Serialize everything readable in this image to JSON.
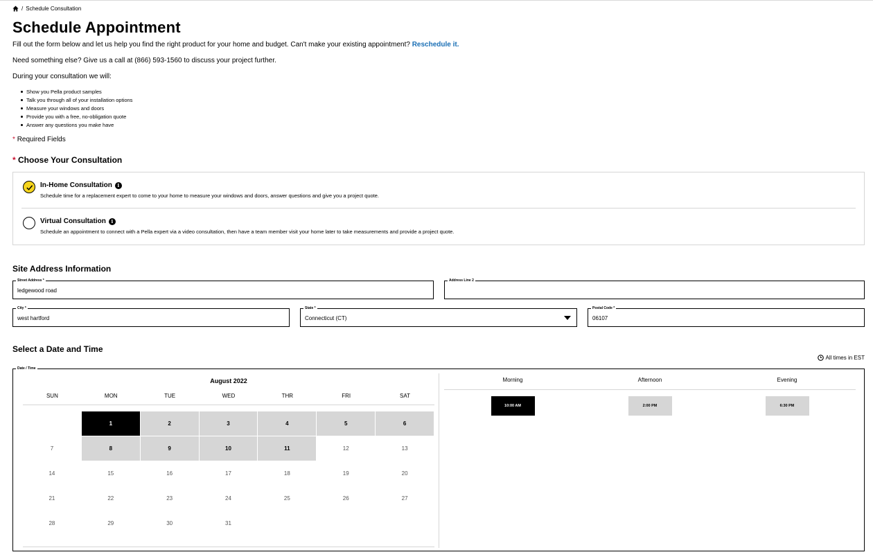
{
  "breadcrumb": {
    "separator": "/",
    "current": "Schedule Consultation"
  },
  "page_title": "Schedule Appointment",
  "intro": {
    "text": "Fill out the form below and let us help you find the right product for your home and budget. Can't make your existing appointment?",
    "link": "Reschedule it."
  },
  "call_text": "Need something else? Give us a call at (866) 593-1560 to discuss your project further.",
  "during_text": "During your consultation we will:",
  "bullets": [
    "Show you Pella product samples",
    "Talk you through all of your installation options",
    "Measure your windows and doors",
    "Provide you with a free, no-obligation quote",
    "Answer any questions you make have"
  ],
  "required": {
    "star": "*",
    "text": "Required Fields"
  },
  "choose": {
    "star": "*",
    "title": "Choose Your Consultation"
  },
  "consultations": [
    {
      "title": "In-Home Consultation",
      "desc": "Schedule time for a replacement expert to come to your home to measure your windows and doors, answer questions and give you a project quote.",
      "selected": true
    },
    {
      "title": "Virtual Consultation",
      "desc": "Schedule an appointment to connect with a Pella expert via a video consultation, then have a team member visit your home later to take measurements and provide a project quote.",
      "selected": false
    }
  ],
  "site_title": "Site Address Information",
  "fields": {
    "street": {
      "label": "Street Address *",
      "value": "ledgewood road"
    },
    "address2": {
      "label": "Address Line 2",
      "value": ""
    },
    "city": {
      "label": "City *",
      "value": "west hartford"
    },
    "state": {
      "label": "State *",
      "value": "Connecticut (CT)"
    },
    "postal": {
      "label": "Postal Code *",
      "value": "06107"
    }
  },
  "date_title": "Select a Date and Time",
  "timezone": "All times in EST",
  "dt_label": "Date / Time",
  "calendar": {
    "month": "August 2022",
    "days_of_week": [
      "SUN",
      "MON",
      "TUE",
      "WED",
      "THR",
      "FRI",
      "SAT"
    ],
    "weeks": [
      [
        "",
        "1",
        "2",
        "3",
        "4",
        "5",
        "6"
      ],
      [
        "7",
        "8",
        "9",
        "10",
        "11",
        "12",
        "13"
      ],
      [
        "14",
        "15",
        "16",
        "17",
        "18",
        "19",
        "20"
      ],
      [
        "21",
        "22",
        "23",
        "24",
        "25",
        "26",
        "27"
      ],
      [
        "28",
        "29",
        "30",
        "31",
        "",
        "",
        ""
      ]
    ],
    "available": [
      "1",
      "2",
      "3",
      "4",
      "5",
      "6",
      "8",
      "9",
      "10",
      "11"
    ],
    "selected": "1"
  },
  "times": {
    "headers": [
      "Morning",
      "Afternoon",
      "Evening"
    ],
    "slots": [
      "10:00 AM",
      "2:00 PM",
      "6:30 PM"
    ],
    "selected": "10:00 AM"
  }
}
